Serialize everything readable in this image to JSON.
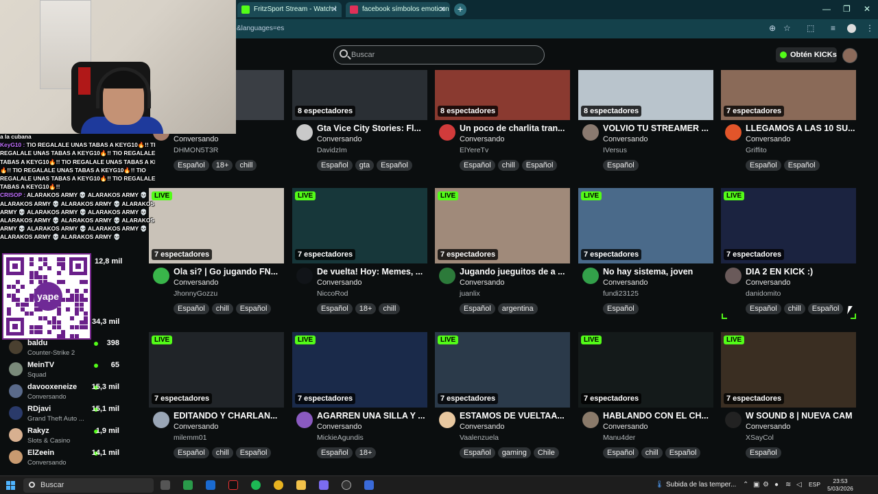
{
  "browser": {
    "tabs": [
      {
        "label": "FritzSport Stream - Watch l",
        "favicon_color": "#53fc18"
      },
      {
        "label": "facebook símbolos emoticon",
        "favicon_color": "#e03058"
      }
    ],
    "url": "&languages=es"
  },
  "header": {
    "search_placeholder": "Buscar",
    "get_kicks_label": "Obtén KICKs"
  },
  "streams": [
    {
      "viewers": "",
      "title": "",
      "category": "Conversando",
      "user": "DHMON5T3R",
      "tags": [
        "Español",
        "18+",
        "chill"
      ],
      "thumb": "#3a3e44",
      "avatar": "#a67c6a",
      "live": false
    },
    {
      "viewers": "8 espectadores",
      "title": "Gta Vice City Stories: Fl...",
      "category": "Conversando",
      "user": "DavidzIm",
      "tags": [
        "Español",
        "gta",
        "Español"
      ],
      "thumb": "#2a2f34",
      "avatar": "#c9c9c9",
      "live": false
    },
    {
      "viewers": "8 espectadores",
      "title": "Un poco de charlita tran...",
      "category": "Conversando",
      "user": "ElYereTv",
      "tags": [
        "Español",
        "chill",
        "Español"
      ],
      "thumb": "#8a3a30",
      "avatar": "#d13b3b",
      "live": false
    },
    {
      "viewers": "8 espectadores",
      "title": "VOLVIO TU STREAMER ...",
      "category": "Conversando",
      "user": "IVersus",
      "tags": [
        "Español"
      ],
      "thumb": "#b9c4cc",
      "avatar": "#8a7a70",
      "live": false
    },
    {
      "viewers": "7 espectadores",
      "title": "LLEGAMOS A LAS 10 SU...",
      "category": "Conversando",
      "user": "Griffito",
      "tags": [
        "Español",
        "Español"
      ],
      "thumb": "#8a6a58",
      "avatar": "#e2552a",
      "live": false
    },
    {
      "viewers": "7 espectadores",
      "title": "Ola si? | Go jugando FN...",
      "category": "Conversando",
      "user": "JhonnyGozzu",
      "tags": [
        "Español",
        "chill",
        "Español"
      ],
      "thumb": "#c9c2b8",
      "avatar": "#39b54a",
      "live": true
    },
    {
      "viewers": "7 espectadores",
      "title": "De vuelta! Hoy: Memes, ...",
      "category": "Conversando",
      "user": "NiccoRod",
      "tags": [
        "Español",
        "18+",
        "chill"
      ],
      "thumb": "#17373a",
      "avatar": "#111418",
      "live": true
    },
    {
      "viewers": "7 espectadores",
      "title": "Jugando jueguitos de a ...",
      "category": "Conversando",
      "user": "juanlix",
      "tags": [
        "Español",
        "argentina"
      ],
      "thumb": "#a08a7a",
      "avatar": "#2c7a3a",
      "live": true
    },
    {
      "viewers": "7 espectadores",
      "title": "No hay sistema, joven",
      "category": "Conversando",
      "user": "fundi23125",
      "tags": [
        "Español"
      ],
      "thumb": "#4a6a8a",
      "avatar": "#33a04a",
      "live": true
    },
    {
      "viewers": "7 espectadores",
      "title": "DIA 2 EN KICK :)",
      "category": "Conversando",
      "user": "danidomito",
      "tags": [
        "Español",
        "chill",
        "Español"
      ],
      "thumb": "#1b2340",
      "avatar": "#6a5a5a",
      "live": true
    },
    {
      "viewers": "7 espectadores",
      "title": "EDITANDO Y CHARLAN...",
      "category": "Conversando",
      "user": "milemm01",
      "tags": [
        "Español",
        "chill",
        "Español"
      ],
      "thumb": "#202428",
      "avatar": "#9aa6b6",
      "live": true
    },
    {
      "viewers": "7 espectadores",
      "title": "AGARREN UNA SILLA Y ...",
      "category": "Conversando",
      "user": "MickieAgundis",
      "tags": [
        "Español",
        "18+"
      ],
      "thumb": "#1a2a4a",
      "avatar": "#8a5ac0",
      "live": true
    },
    {
      "viewers": "7 espectadores",
      "title": "ESTAMOS DE VUELTAA...",
      "category": "Conversando",
      "user": "Vaalenzuela",
      "tags": [
        "Español",
        "gaming",
        "Chile"
      ],
      "thumb": "#2b3a4a",
      "avatar": "#e8c8a0",
      "live": true
    },
    {
      "viewers": "7 espectadores",
      "title": "HABLANDO CON EL CH...",
      "category": "Conversando",
      "user": "Manu4der",
      "tags": [
        "Español",
        "chill",
        "Español"
      ],
      "thumb": "#141a1a",
      "avatar": "#8a7a6a",
      "live": true
    },
    {
      "viewers": "7 espectadores",
      "title": "W SOUND 8 | NUEVA CAM",
      "category": "Conversando",
      "user": "XSayCol",
      "tags": [
        "Español"
      ],
      "thumb": "#3a2e22",
      "avatar": "#222",
      "live": true
    }
  ],
  "chat": {
    "header": "a la cubana",
    "lines": [
      {
        "name": "KeyG10 :",
        "text": " TIO REGALALE UNAS TABAS A KEYG10🔥!! TIO"
      },
      {
        "name": "",
        "text": "REGALALE UNAS TABAS A KEYG10🔥!! TIO REGALALE UNAS"
      },
      {
        "name": "",
        "text": "TABAS A KEYG10🔥!! TIO REGALALE UNAS TABAS A KEYG10"
      },
      {
        "name": "",
        "text": "🔥!! TIO REGALALE UNAS TABAS A KEYG10🔥!! TIO"
      },
      {
        "name": "",
        "text": "REGALALE UNAS TABAS A KEYG10🔥!! TIO REGALALE UNAS"
      },
      {
        "name": "",
        "text": "TABAS A KEYG10🔥!!"
      },
      {
        "name": "CRISOP :",
        "text": " ALARAKOS ARMY 💀 ALARAKOS ARMY 💀"
      },
      {
        "name": "",
        "text": "ALARAKOS ARMY 💀 ALARAKOS ARMY 💀 ALARAKOS"
      },
      {
        "name": "",
        "text": "ARMY 💀 ALARAKOS ARMY 💀 ALARAKOS ARMY 💀"
      },
      {
        "name": "",
        "text": "ALARAKOS ARMY 💀 ALARAKOS ARMY 💀 ALARAKOS"
      },
      {
        "name": "",
        "text": "ARMY 💀 ALARAKOS ARMY 💀 ALARAKOS ARMY 💀"
      },
      {
        "name": "",
        "text": "ALARAKOS ARMY 💀 ALARAKOS ARMY 💀"
      }
    ]
  },
  "qr": {
    "label": "yape"
  },
  "sidebar_overlay_counts": [
    "12,8 mil",
    "34,3 mil",
    "14,1 mil"
  ],
  "sidebar": [
    {
      "name": "baldu",
      "category": "Counter-Strike 2",
      "count": "398",
      "avatar": "#4a4030"
    },
    {
      "name": "MeinTV",
      "category": "Squad",
      "count": "65",
      "avatar": "#7a8a7a"
    },
    {
      "name": "davooxeneize",
      "category": "Conversando",
      "count": "15,3 mil",
      "avatar": "#5a6a8a"
    },
    {
      "name": "RDjavi",
      "category": "Grand Theft Auto ...",
      "count": "15,1 mil",
      "avatar": "#2a3a6a"
    },
    {
      "name": "Rakyz",
      "category": "Slots & Casino",
      "count": "1,9 mil",
      "avatar": "#d8b090"
    },
    {
      "name": "ElZeein",
      "category": "Conversando",
      "count": "14,1 mil",
      "avatar": "#c89a70"
    }
  ],
  "taskbar": {
    "search_label": "Buscar",
    "weather": "Subida de las temper...",
    "lang": "ESP",
    "time": "23:53",
    "date": "5/03/2026"
  }
}
